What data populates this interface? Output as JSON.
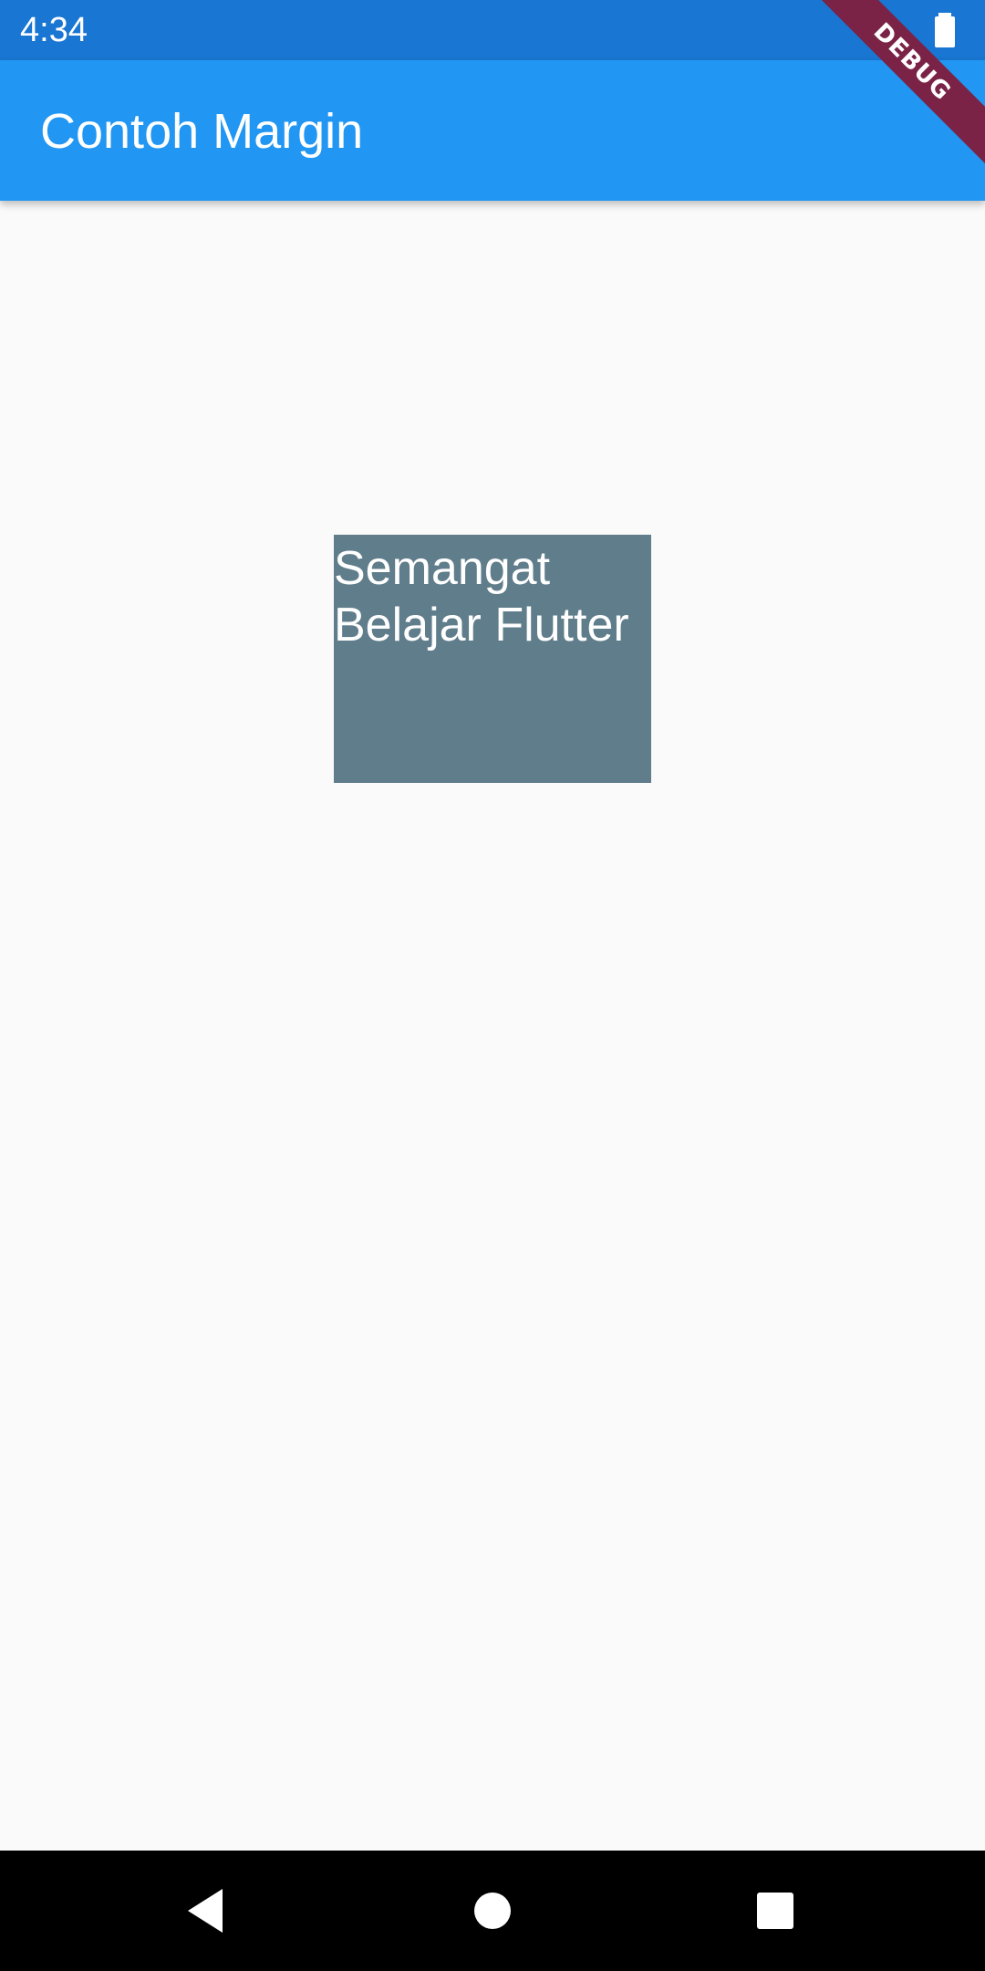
{
  "status_bar": {
    "time": "4:34",
    "battery_icon": "battery-full-icon"
  },
  "app_bar": {
    "title": "Contoh Margin",
    "background_color": "#2196f3"
  },
  "debug_banner": {
    "label": "DEBUG"
  },
  "content": {
    "box_text": "Semangat Belajar Flutter",
    "box_color": "#607d8b"
  },
  "nav_bar": {
    "back_icon": "back-triangle-icon",
    "home_icon": "home-circle-icon",
    "recents_icon": "recents-square-icon"
  }
}
